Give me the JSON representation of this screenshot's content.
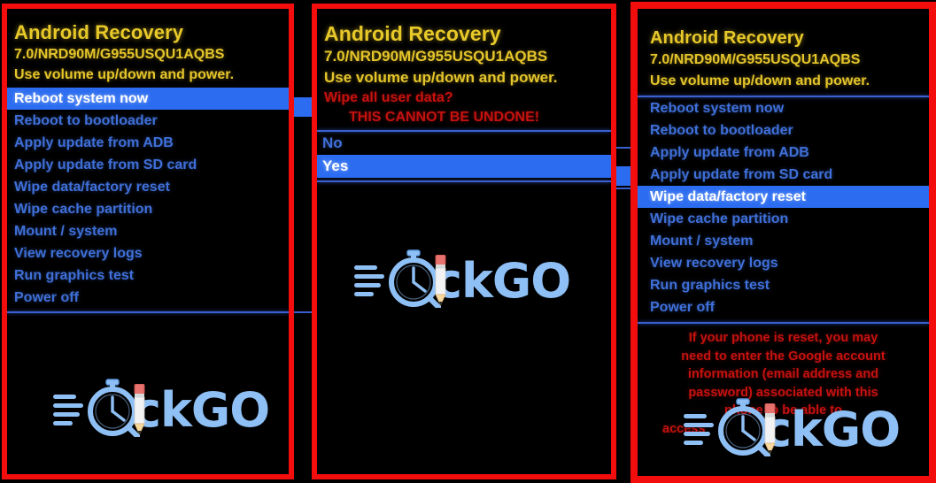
{
  "meta": {
    "screen_title": "Android Recovery",
    "build": "7.0/NRD90M/G955USQU1AQBS",
    "hint": "Use volume up/down and power.",
    "colors": {
      "frame_red": "#f40d0d",
      "title_yellow": "#e8c92a",
      "menu_blue": "#3f6fd8",
      "highlight_blue": "#2b6cf0",
      "warning_red": "#c5120f",
      "rule_blue": "#3a5fd0",
      "background": "#000000",
      "logo_blue": "#8fc0f5"
    }
  },
  "logo": {
    "name": "quickgo-logo",
    "text_prefix": "Q",
    "text_mid": "u",
    "text_i": "i",
    "text_suffix": "ckGO",
    "full": "QuickGO"
  },
  "panels": [
    {
      "id": "panel-1-main-menu",
      "title": "Android Recovery",
      "build": "7.0/NRD90M/G955USQU1AQBS",
      "hint": "Use volume up/down and power.",
      "menu": [
        {
          "label": "Reboot system now",
          "selected": true
        },
        {
          "label": "Reboot to bootloader",
          "selected": false
        },
        {
          "label": "Apply update from ADB",
          "selected": false
        },
        {
          "label": "Apply update from SD card",
          "selected": false
        },
        {
          "label": "Wipe data/factory reset",
          "selected": false
        },
        {
          "label": "Wipe cache partition",
          "selected": false
        },
        {
          "label": "Mount / system",
          "selected": false
        },
        {
          "label": "View recovery logs",
          "selected": false
        },
        {
          "label": "Run graphics test",
          "selected": false
        },
        {
          "label": "Power off",
          "selected": false
        }
      ]
    },
    {
      "id": "panel-2-confirm-wipe",
      "title": "Android Recovery",
      "build": "7.0/NRD90M/G955USQU1AQBS",
      "hint": "Use volume up/down and power.",
      "prompt": "Wipe all user data?",
      "prompt_caps": "THIS CANNOT BE UNDONE!",
      "menu": [
        {
          "label": "No",
          "selected": false
        },
        {
          "label": "Yes",
          "selected": true
        }
      ]
    },
    {
      "id": "panel-3-wipe-selected",
      "title": "Android Recovery",
      "build": "7.0/NRD90M/G955USQU1AQBS",
      "hint": "Use volume up/down and power.",
      "menu": [
        {
          "label": "Reboot system now",
          "selected": false
        },
        {
          "label": "Reboot to bootloader",
          "selected": false
        },
        {
          "label": "Apply update from ADB",
          "selected": false
        },
        {
          "label": "Apply update from SD card",
          "selected": false
        },
        {
          "label": "Wipe data/factory reset",
          "selected": true
        },
        {
          "label": "Wipe cache partition",
          "selected": false
        },
        {
          "label": "Mount / system",
          "selected": false
        },
        {
          "label": "View recovery logs",
          "selected": false
        },
        {
          "label": "Run graphics test",
          "selected": false
        },
        {
          "label": "Power off",
          "selected": false
        }
      ],
      "notice_lines": [
        "If your phone is reset, you may",
        "need to enter the Google account",
        "information (email address and",
        "password) associated with this",
        "phone to be able to",
        "access"
      ]
    }
  ]
}
